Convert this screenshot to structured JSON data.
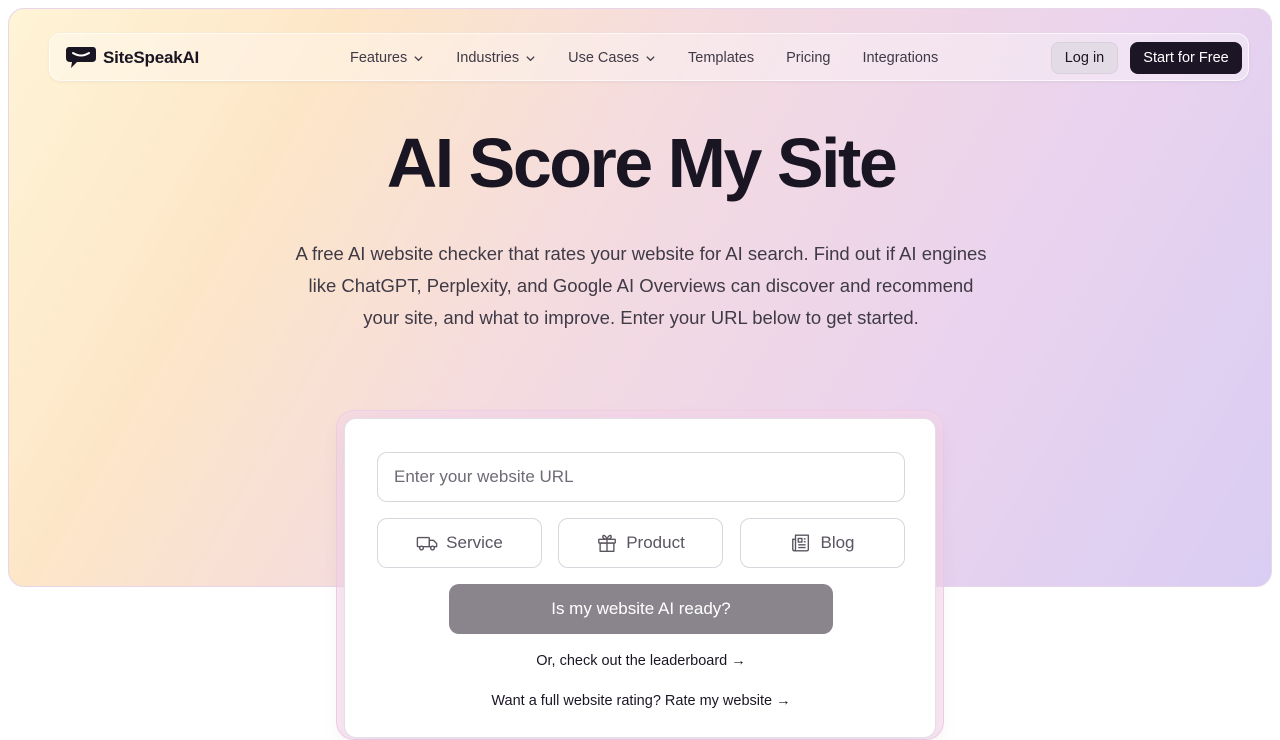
{
  "brand": {
    "name": "SiteSpeakAI"
  },
  "nav": {
    "items": [
      {
        "label": "Features",
        "has_dropdown": true
      },
      {
        "label": "Industries",
        "has_dropdown": true
      },
      {
        "label": "Use Cases",
        "has_dropdown": true
      },
      {
        "label": "Templates",
        "has_dropdown": false
      },
      {
        "label": "Pricing",
        "has_dropdown": false
      },
      {
        "label": "Integrations",
        "has_dropdown": false
      }
    ],
    "login_label": "Log in",
    "start_label": "Start for Free"
  },
  "hero": {
    "title": "AI Score My Site",
    "subtitle": "A free AI website checker that rates your website for AI search. Find out if AI engines like ChatGPT, Perplexity, and Google AI Overviews can discover and recommend your site, and what to improve. Enter your URL below to get started."
  },
  "form": {
    "url_placeholder": "Enter your website URL",
    "url_value": "",
    "types": [
      {
        "label": "Service",
        "icon": "truck-icon"
      },
      {
        "label": "Product",
        "icon": "gift-icon"
      },
      {
        "label": "Blog",
        "icon": "newspaper-icon"
      }
    ],
    "submit_label": "Is my website AI ready?",
    "leaderboard_link": "Or, check out the leaderboard →",
    "rate_link": "Want a full website rating? Rate my website →"
  },
  "colors": {
    "primary_dark": "#1c1525",
    "submit_disabled": "#8a858d",
    "gradient_start": "#fff4d6",
    "gradient_end": "#d9cdf3"
  }
}
